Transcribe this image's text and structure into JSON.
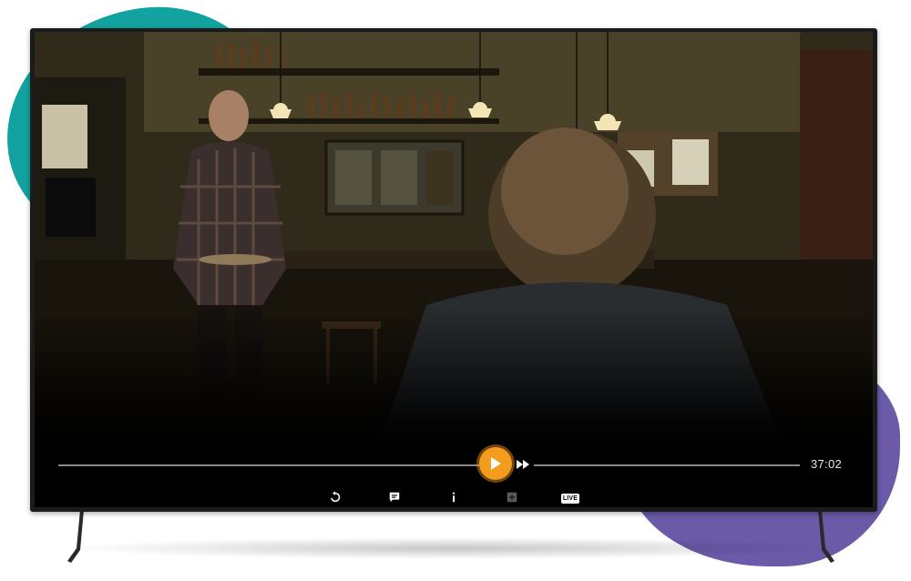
{
  "player": {
    "elapsed_fraction": 0.53,
    "time_label": "37:02"
  },
  "controls": {
    "play_icon": "play-icon",
    "fast_forward_icon": "fast-forward-icon",
    "buttons": [
      {
        "icon": "replay-icon"
      },
      {
        "icon": "subtitles-icon"
      },
      {
        "icon": "info-icon"
      },
      {
        "icon": "add-icon"
      }
    ],
    "live_label": "LIVE"
  },
  "colors": {
    "accent": "#f39c1e",
    "blob_teal": "#12a3a1",
    "blob_purple": "#6a5aa8"
  }
}
